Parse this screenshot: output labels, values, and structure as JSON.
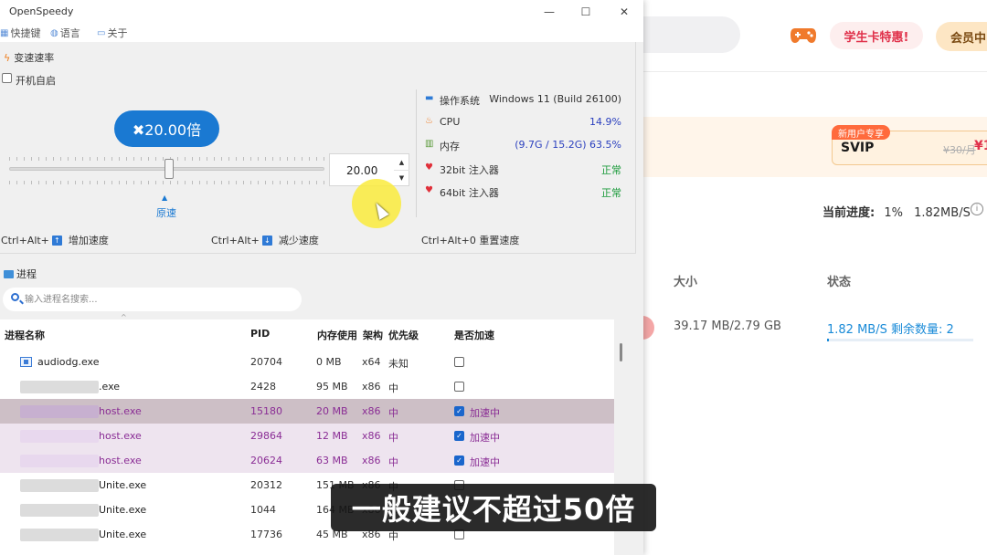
{
  "background_app": {
    "student_promo": "学生卡特惠!",
    "vip_button": "会员中",
    "new_user_tag": "新用户专享",
    "svip_label": "SVIP",
    "svip_price_old": "¥30/月",
    "svip_price_new": "¥1",
    "progress_label": "当前进度:",
    "progress_percent": "1%",
    "progress_speed": "1.82MB/S",
    "progress_fraction": 0.01,
    "col_size": "大小",
    "col_status": "状态",
    "file_size": "39.17 MB/2.79 GB",
    "file_status": "1.82 MB/S 剩余数量: 2"
  },
  "window": {
    "title": "OpenSpeedy",
    "controls": {
      "minimize": "—",
      "maximize": "☐",
      "close": "✕"
    }
  },
  "menu": {
    "hotkeys": "快捷键",
    "language": "语言",
    "about": "关于"
  },
  "speed_section": {
    "title": "变速速率",
    "autostart_label": "开机自启",
    "autostart_checked": false,
    "speed_display": "✖20.00倍",
    "slider_value": 20.0,
    "origin_label": "原速",
    "spin_value": "20.00"
  },
  "system": {
    "os_label": "操作系统",
    "os_value": "Windows 11 (Build 26100)",
    "cpu_label": "CPU",
    "cpu_value": "14.9%",
    "mem_label": "内存",
    "mem_value": "(9.7G / 15.2G) 63.5%",
    "inj32_label": "32bit 注入器",
    "inj32_value": "正常",
    "inj64_label": "64bit 注入器",
    "inj64_value": "正常",
    "status_ok_color": "#1a9a3a",
    "accent_color": "#2a52be"
  },
  "hotkeys": {
    "increase_combo": "Ctrl+Alt+",
    "increase_label": "增加速度",
    "decrease_combo": "Ctrl+Alt+",
    "decrease_label": "减少速度",
    "reset_label": "Ctrl+Alt+0 重置速度"
  },
  "process": {
    "title": "进程",
    "search_placeholder": "输入进程名搜索...",
    "columns": [
      "进程名称",
      "PID",
      "内存使用",
      "架构",
      "优先级",
      "是否加速"
    ],
    "rows": [
      {
        "name": "audiodg.exe",
        "pid": "20704",
        "mem": "0 MB",
        "arch": "x64",
        "priority": "未知",
        "accelerated": false,
        "accel_label": ""
      },
      {
        "name": ".exe",
        "pid": "2428",
        "mem": "95 MB",
        "arch": "x86",
        "priority": "中",
        "accelerated": false,
        "accel_label": ""
      },
      {
        "name": "host.exe",
        "pid": "15180",
        "mem": "20 MB",
        "arch": "x86",
        "priority": "中",
        "accelerated": true,
        "accel_label": "加速中"
      },
      {
        "name": "host.exe",
        "pid": "29864",
        "mem": "12 MB",
        "arch": "x86",
        "priority": "中",
        "accelerated": true,
        "accel_label": "加速中"
      },
      {
        "name": "host.exe",
        "pid": "20624",
        "mem": "63 MB",
        "arch": "x86",
        "priority": "中",
        "accelerated": true,
        "accel_label": "加速中"
      },
      {
        "name": "Unite.exe",
        "pid": "20312",
        "mem": "151 MB",
        "arch": "x86",
        "priority": "中",
        "accelerated": false,
        "accel_label": ""
      },
      {
        "name": "Unite.exe",
        "pid": "1044",
        "mem": "164 MB",
        "arch": "x86",
        "priority": "中",
        "accelerated": false,
        "accel_label": ""
      },
      {
        "name": "Unite.exe",
        "pid": "17736",
        "mem": "45 MB",
        "arch": "x86",
        "priority": "中",
        "accelerated": false,
        "accel_label": ""
      }
    ]
  },
  "caption": "一般建议不超过50倍"
}
